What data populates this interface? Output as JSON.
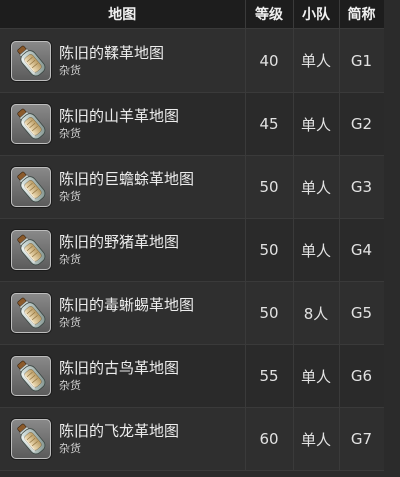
{
  "table": {
    "headers": {
      "name": "地图",
      "level": "等级",
      "party": "小队",
      "abbr": "简称"
    },
    "rows": [
      {
        "name": "陈旧的鞣革地图",
        "category": "杂货",
        "level": "40",
        "party": "单人",
        "abbr": "G1",
        "icon": "map-bottle-icon"
      },
      {
        "name": "陈旧的山羊革地图",
        "category": "杂货",
        "level": "45",
        "party": "单人",
        "abbr": "G2",
        "icon": "map-bottle-icon"
      },
      {
        "name": "陈旧的巨蟾蜍革地图",
        "category": "杂货",
        "level": "50",
        "party": "单人",
        "abbr": "G3",
        "icon": "map-bottle-icon"
      },
      {
        "name": "陈旧的野猪革地图",
        "category": "杂货",
        "level": "50",
        "party": "单人",
        "abbr": "G4",
        "icon": "map-bottle-icon"
      },
      {
        "name": "陈旧的毒蜥蜴革地图",
        "category": "杂货",
        "level": "50",
        "party": "8人",
        "abbr": "G5",
        "icon": "map-bottle-icon"
      },
      {
        "name": "陈旧的古鸟革地图",
        "category": "杂货",
        "level": "55",
        "party": "单人",
        "abbr": "G6",
        "icon": "map-bottle-icon"
      },
      {
        "name": "陈旧的飞龙革地图",
        "category": "杂货",
        "level": "60",
        "party": "单人",
        "abbr": "G7",
        "icon": "map-bottle-icon"
      }
    ]
  }
}
